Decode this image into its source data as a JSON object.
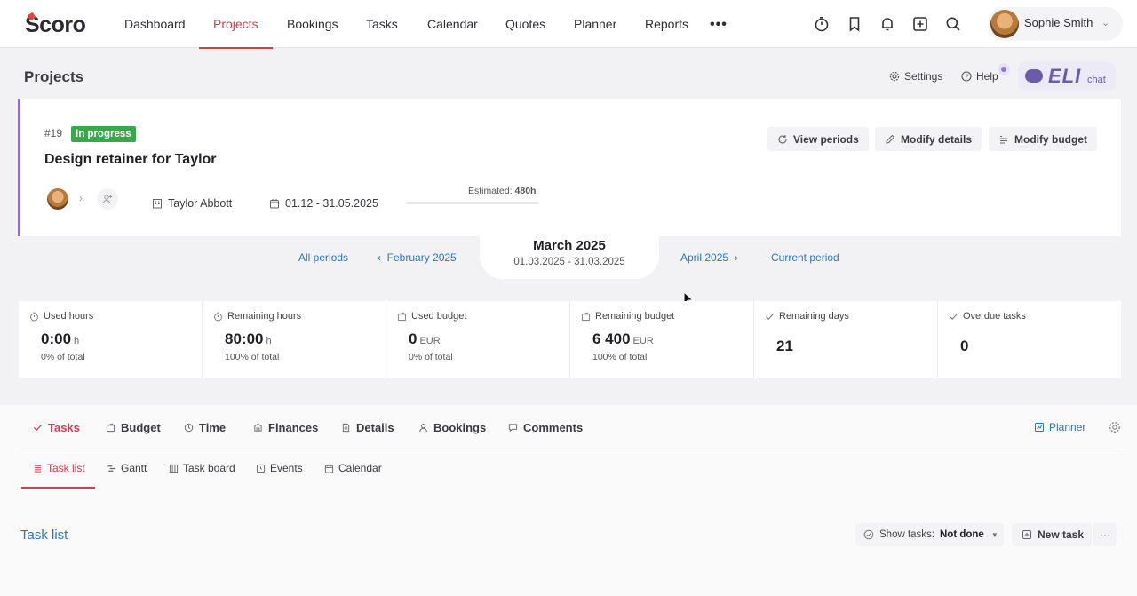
{
  "logo": "Scoro",
  "nav": {
    "items": [
      "Dashboard",
      "Projects",
      "Bookings",
      "Tasks",
      "Calendar",
      "Quotes",
      "Planner",
      "Reports"
    ],
    "more": "•••",
    "user_name": "Sophie Smith"
  },
  "page": {
    "title": "Projects",
    "settings": "Settings",
    "help": "Help",
    "eli_text": "ELI",
    "eli_chat": "chat"
  },
  "project": {
    "number": "#19",
    "status": "In progress",
    "title": "Design retainer for Taylor",
    "client": "Taylor Abbott",
    "dates": "01.12 - 31.05.2025",
    "estimated_label": "Estimated:",
    "estimated_value": "480h",
    "estimated_progress": 0,
    "buttons": {
      "view_periods": "View periods",
      "modify_details": "Modify details",
      "modify_budget": "Modify budget"
    }
  },
  "period": {
    "all_periods": "All periods",
    "prev": "February 2025",
    "current_title": "March 2025",
    "current_range": "01.03.2025 - 31.03.2025",
    "next": "April 2025",
    "current_period": "Current period"
  },
  "stats": [
    {
      "label": "Used hours",
      "value": "0:00",
      "unit": "h",
      "sub": "0% of total"
    },
    {
      "label": "Remaining hours",
      "value": "80:00",
      "unit": "h",
      "sub": "100% of total"
    },
    {
      "label": "Used budget",
      "value": "0",
      "unit": "EUR",
      "sub": "0% of total"
    },
    {
      "label": "Remaining budget",
      "value": "6 400",
      "unit": "EUR",
      "sub": "100% of total"
    },
    {
      "label": "Remaining days",
      "value": "21",
      "unit": "",
      "sub": ""
    },
    {
      "label": "Overdue tasks",
      "value": "0",
      "unit": "",
      "sub": ""
    }
  ],
  "tabs": {
    "main": [
      "Tasks",
      "Budget",
      "Time",
      "Finances",
      "Details",
      "Bookings",
      "Comments"
    ],
    "planner": "Planner",
    "sub": [
      "Task list",
      "Gantt",
      "Task board",
      "Events",
      "Calendar"
    ]
  },
  "tasklist": {
    "title": "Task list",
    "filter_label": "Show tasks:",
    "filter_value": "Not done",
    "new_task": "New task",
    "more": "···"
  },
  "colors": {
    "accent": "#d63b50",
    "link": "#2f74c0",
    "status_green": "#3aa74a",
    "eli_purple": "#6b5ca8"
  }
}
